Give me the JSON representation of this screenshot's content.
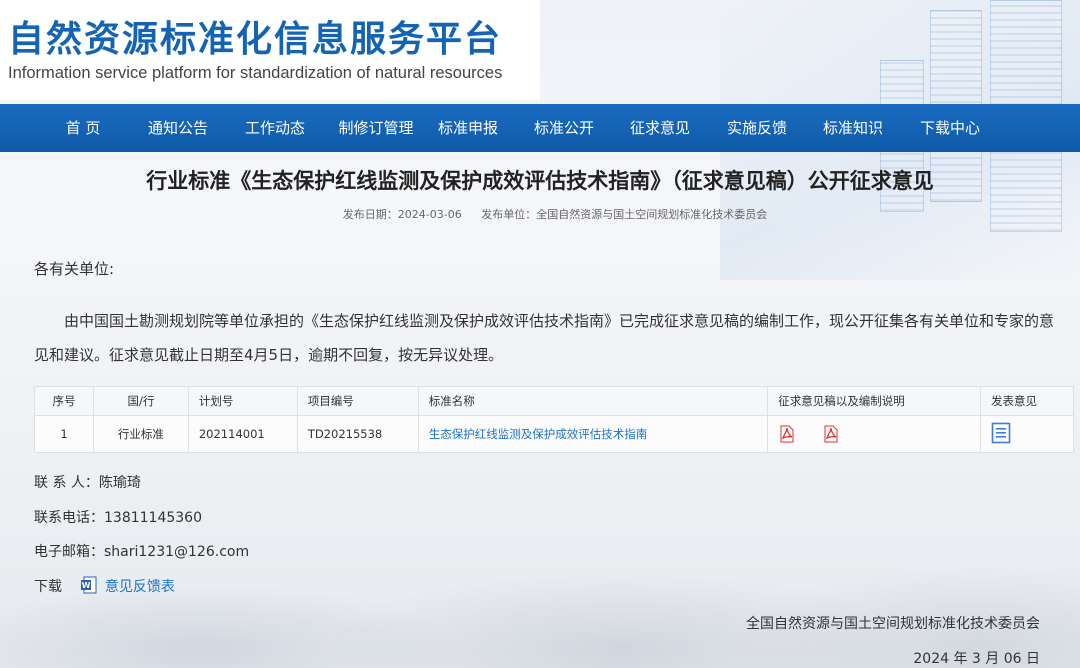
{
  "site": {
    "title_cn": "自然资源标准化信息服务平台",
    "title_en": "Information service platform for standardization of natural resources"
  },
  "nav": {
    "items": [
      {
        "label": "首 页"
      },
      {
        "label": "通知公告"
      },
      {
        "label": "工作动态"
      },
      {
        "label": "制修订管理"
      },
      {
        "label": "标准申报"
      },
      {
        "label": "标准公开"
      },
      {
        "label": "征求意见"
      },
      {
        "label": "实施反馈"
      },
      {
        "label": "标准知识"
      },
      {
        "label": "下载中心"
      }
    ]
  },
  "article": {
    "title": "行业标准《生态保护红线监测及保护成效评估技术指南》（征求意见稿）公开征求意见",
    "publish_date": "发布日期：2024-03-06",
    "publisher": "发布单位：全国自然资源与国土空间规划标准化技术委员会",
    "salutation": "各有关单位:",
    "body": "由中国国土勘测规划院等单位承担的《生态保护红线监测及保护成效评估技术指南》已完成征求意见稿的编制工作，现公开征集各有关单位和专家的意见和建议。征求意见截止日期至4月5日，逾期不回复，按无异议处理。"
  },
  "table": {
    "headers": [
      "序号",
      "国/行",
      "计划号",
      "项目编号",
      "标准名称",
      "征求意见稿以及编制说明",
      "发表意见"
    ],
    "rows": [
      {
        "index": "1",
        "level": "行业标准",
        "plan_no": "202114001",
        "project_no": "TD20215538",
        "name": "生态保护红线监测及保护成效评估技术指南"
      }
    ]
  },
  "contact": {
    "person": "联 系 人：陈瑜琦",
    "phone": "联系电话：13811145360",
    "email": "电子邮箱：shari1231@126.com"
  },
  "download": {
    "label": "下载",
    "file": "意见反馈表"
  },
  "signature": {
    "org": "全国自然资源与国土空间规划标准化技术委员会",
    "date": "2024 年 3 月 06 日"
  },
  "colors": {
    "brand_blue": "#1464b4",
    "nav_blue": "#0f5aa8",
    "link_blue": "#1e73c8",
    "pdf_red": "#d9322c"
  }
}
